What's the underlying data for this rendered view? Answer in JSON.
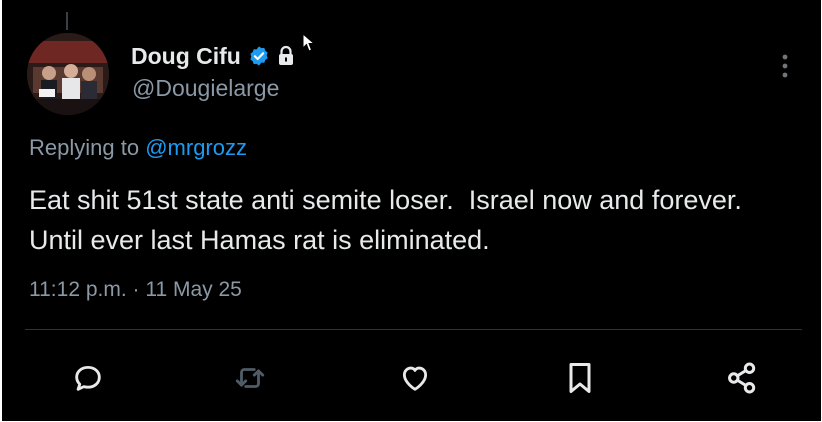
{
  "author": {
    "display_name": "Doug Cifu",
    "handle": "@Dougielarge",
    "verified": true,
    "protected": true
  },
  "reply": {
    "prefix": "Replying to",
    "mention": "@mrgrozz"
  },
  "tweet": {
    "text": "Eat shit 51st state anti semite loser.  Israel now and forever.  Until ever last Hamas rat is eliminated.",
    "timestamp": "11:12 p.m. · 11 May 25"
  },
  "actions": [
    {
      "name": "reply",
      "icon": "reply-icon"
    },
    {
      "name": "repost",
      "icon": "repost-icon"
    },
    {
      "name": "like",
      "icon": "heart-icon"
    },
    {
      "name": "bookmark",
      "icon": "bookmark-icon"
    },
    {
      "name": "share",
      "icon": "share-icon"
    }
  ],
  "colors": {
    "background": "#000000",
    "primary_text": "#e7e9ea",
    "secondary_text": "#8b98a5",
    "accent": "#1d9bf0",
    "repost_icon": "#4f5b66",
    "divider": "#2f3336"
  }
}
